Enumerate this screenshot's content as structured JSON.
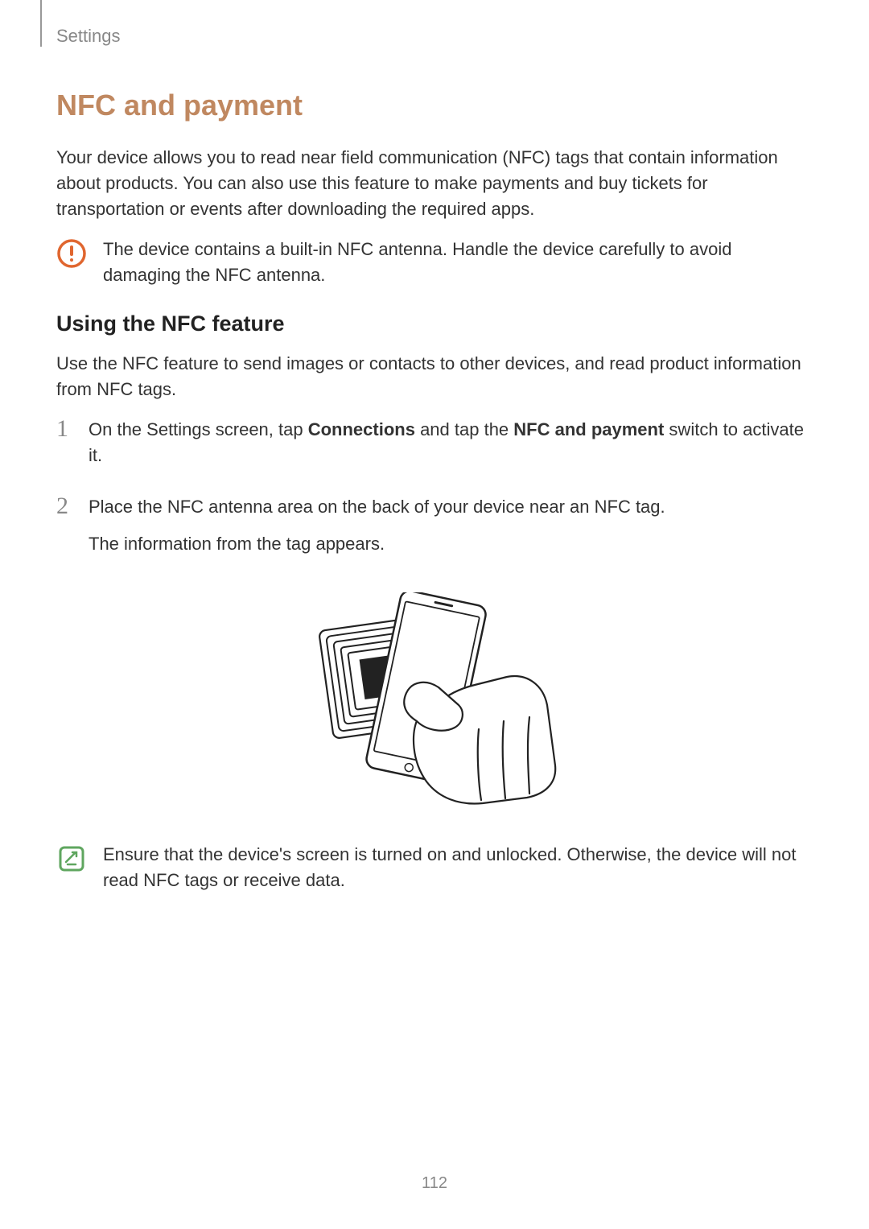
{
  "header": {
    "breadcrumb": "Settings"
  },
  "section": {
    "title": "NFC and payment",
    "intro": "Your device allows you to read near field communication (NFC) tags that contain information about products. You can also use this feature to make payments and buy tickets for transportation or events after downloading the required apps."
  },
  "callouts": {
    "warning": "The device contains a built-in NFC antenna. Handle the device carefully to avoid damaging the NFC antenna.",
    "note": "Ensure that the device's screen is turned on and unlocked. Otherwise, the device will not read NFC tags or receive data."
  },
  "subsection": {
    "title": "Using the NFC feature",
    "intro": "Use the NFC feature to send images or contacts to other devices, and read product information from NFC tags."
  },
  "steps": [
    {
      "num": "1",
      "pre": "On the Settings screen, tap ",
      "bold1": "Connections",
      "mid": " and tap the ",
      "bold2": "NFC and payment",
      "post": " switch to activate it."
    },
    {
      "num": "2",
      "line1": "Place the NFC antenna area on the back of your device near an NFC tag.",
      "line2": "The information from the tag appears."
    }
  ],
  "page_number": "112"
}
